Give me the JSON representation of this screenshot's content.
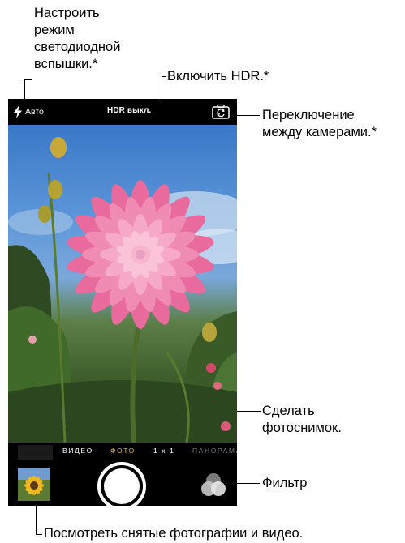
{
  "camera": {
    "flash_label": "Авто",
    "hdr_label": "HDR выкл.",
    "modes": [
      {
        "label": "ВИДЕО",
        "state": "normal"
      },
      {
        "label": "ФОТО",
        "state": "active"
      },
      {
        "label": "1 x 1",
        "state": "normal"
      },
      {
        "label": "ПАНОРАМА",
        "state": "dim"
      }
    ],
    "accent_color": "#f1b833"
  },
  "callouts": {
    "flash": "Настроить\nрежим\nсветодиодной\nвспышки.*",
    "hdr": "Включить HDR.*",
    "switch_camera": "Переключение\nмежду камерами.*",
    "shutter": "Сделать\nфотоснимок.",
    "filter": "Фильтр",
    "thumbnail": "Посмотреть снятые фотографии и видео."
  },
  "icons": {
    "flash": "flash-bolt-icon",
    "switch_camera": "camera-switch-icon",
    "filter": "filter-circles-icon"
  }
}
